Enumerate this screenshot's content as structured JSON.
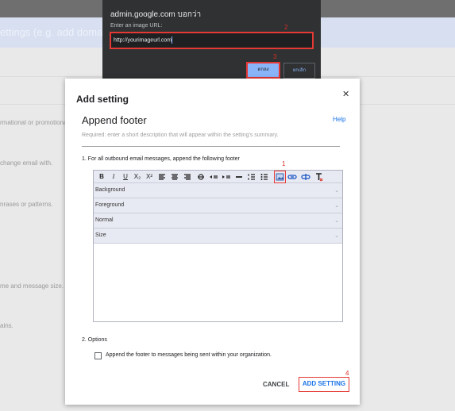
{
  "background": {
    "header_text": "ettings (e.g. add domain)",
    "snippets": [
      "rmational or promotiona",
      "change email with.",
      "nrases or patterns.",
      "me and message size.",
      "ains."
    ]
  },
  "prompt": {
    "title": "admin.google.com บอกว่า",
    "label": "Enter an image URL:",
    "value": "http://yourimageurl.com",
    "ok_label": "ตกลง",
    "cancel_label": "ยกเลิก"
  },
  "steps": {
    "s1": "1",
    "s2": "2",
    "s3": "3",
    "s4": "4"
  },
  "dialog": {
    "title": "Add setting",
    "close_glyph": "✕",
    "section_title": "Append footer",
    "help_label": "Help",
    "description_placeholder": "Required: enter a short description that will appear within the setting's summary.",
    "field_label": "1. For all outbound email messages, append the following footer",
    "toolbar": {
      "bold": "B",
      "italic": "I",
      "underline": "U",
      "subscript": "X₂",
      "superscript": "X²"
    },
    "dropdowns": [
      "Background",
      "Foreground",
      "Normal",
      "Size"
    ],
    "options_label": "2. Options",
    "checkbox_label": "Append the footer to messages being sent within your organization.",
    "cancel_label": "CANCEL",
    "add_label": "ADD SETTING"
  },
  "colors": {
    "accent": "#1a73e8",
    "highlight": "#e53935",
    "toolbar_bg": "#e8eaf3"
  }
}
